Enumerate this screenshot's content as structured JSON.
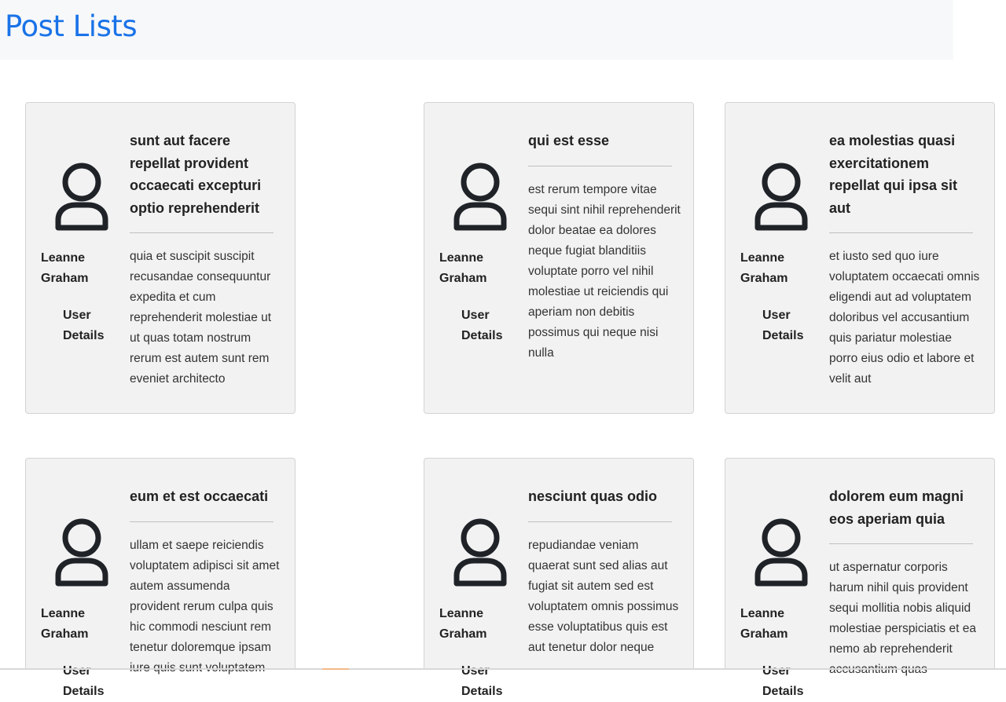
{
  "page_title": "Post Lists",
  "posts": [
    {
      "author": "Leanne Graham",
      "details_link": "User Details",
      "title": "sunt aut facere repellat provident occaecati excepturi optio reprehenderit",
      "body": "quia et suscipit suscipit recusandae consequuntur expedita et cum reprehenderit molestiae ut ut quas totam nostrum rerum est autem sunt rem eveniet architecto"
    },
    {
      "author": "Leanne Graham",
      "details_link": "User Details",
      "title": "qui est esse",
      "body": "est rerum tempore vitae sequi sint nihil reprehenderit dolor beatae ea dolores neque fugiat blanditiis voluptate porro vel nihil molestiae ut reiciendis qui aperiam non debitis possimus qui neque nisi nulla"
    },
    {
      "author": "Leanne Graham",
      "details_link": "User Details",
      "title": "ea molestias quasi exercitationem repellat qui ipsa sit aut",
      "body": "et iusto sed quo iure voluptatem occaecati omnis eligendi aut ad voluptatem doloribus vel accusantium quis pariatur molestiae porro eius odio et labore et velit aut"
    },
    {
      "author": "Leanne Graham",
      "details_link": "User Details",
      "title": "eum et est occaecati",
      "body": "ullam et saepe reiciendis voluptatem adipisci sit amet autem assumenda provident rerum culpa quis hic commodi nesciunt rem tenetur doloremque ipsam iure quis sunt voluptatem"
    },
    {
      "author": "Leanne Graham",
      "details_link": "User Details",
      "title": "nesciunt quas odio",
      "body": "repudiandae veniam quaerat sunt sed alias aut fugiat sit autem sed est voluptatem omnis possimus esse voluptatibus quis est aut tenetur dolor neque"
    },
    {
      "author": "Leanne Graham",
      "details_link": "User Details",
      "title": "dolorem eum magni eos aperiam quia",
      "body": "ut aspernatur corporis harum nihil quis provident sequi mollitia nobis aliquid molestiae perspiciatis et ea nemo ab reprehenderit accusantium quas"
    }
  ],
  "colors": {
    "title": "#1a73e8",
    "header_bg": "#f7f8fa",
    "card_bg": "#f2f2f2",
    "card_border": "#d3d3d3"
  },
  "icons": {
    "avatar": "user-outline-icon"
  }
}
